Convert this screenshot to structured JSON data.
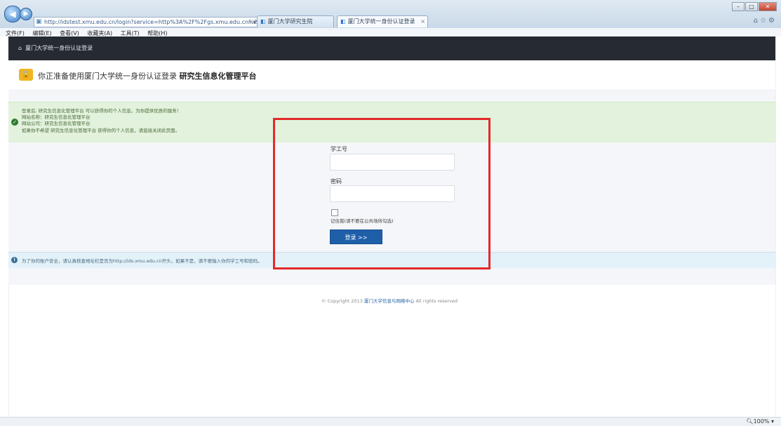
{
  "browser": {
    "address_url": "http://idstest.xmu.edu.cn/login?service=http%3A%2F%2Fgs.xmu.edu.cn%2Fa",
    "tabs": [
      {
        "label": "厦门大学研究生院"
      },
      {
        "label": "厦门大学统一身份认证登录"
      }
    ],
    "menu": [
      "文件(F)",
      "编辑(E)",
      "查看(V)",
      "收藏夹(A)",
      "工具(T)",
      "帮助(H)"
    ],
    "zoom": "100%"
  },
  "header": {
    "breadcrumb": "厦门大学统一身份认证登录"
  },
  "title": {
    "prefix": "你正准备使用厦门大学统一身份认证登录",
    "system": "研究生信息化管理平台"
  },
  "success_info": {
    "lines": [
      "登录后, 研究生信息化管理平台 可以获得你的个人信息，为你提供优质的服务！",
      "网站名称：研究生信息化管理平台",
      "网站公司：研究生信息化管理平台",
      "如果你不希望 研究生信息化管理平台 获得你的个人信息，请直接关闭此页面。"
    ]
  },
  "form": {
    "username_label": "学工号",
    "username_value": "",
    "password_label": "密码",
    "password_value": "",
    "remember_label": "记住我(请不要在公共场所勾选)",
    "login_button": "登录 >>"
  },
  "notice": {
    "text": "为了你的账户安全，请认真核查地址栏是否为http://ids.xmu.edu.cn开头，如果不是，请不要输入你的学工号和密码。"
  },
  "footer": {
    "copyright": "© Copyright 2013",
    "org": "厦门大学信息与网络中心",
    "rights": "All rights reserved"
  },
  "colors": {
    "header_bg": "#262a33",
    "success_bg": "#e2f2dc",
    "notice_bg": "#e3f1f8",
    "button_bg": "#1f5fa8",
    "highlight": "#e22a2a",
    "lock_badge": "#f1b423"
  }
}
